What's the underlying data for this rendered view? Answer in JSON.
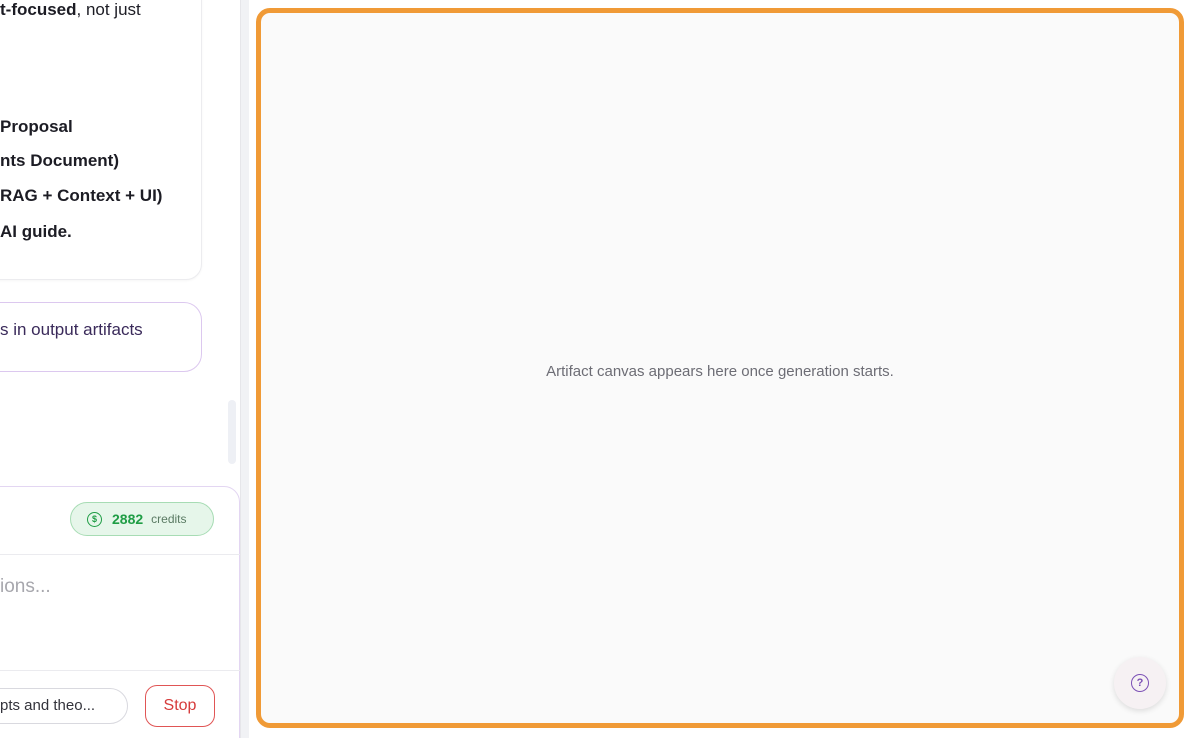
{
  "chat": {
    "assistant_lines": [
      {
        "bold": "t-focused",
        "rest": ", not just"
      },
      "Proposal",
      "nts Document)",
      "RAG + Context + UI)",
      "AI guide."
    ],
    "user_message": "s in output artifacts"
  },
  "composer": {
    "credits": {
      "count": "2882",
      "label": "credits",
      "icon": "dollar-coin-icon"
    },
    "placeholder": "ions...",
    "suggestion": "pts and theo...",
    "stop_label": "Stop"
  },
  "canvas": {
    "empty_message": "Artifact canvas appears here once generation starts.",
    "help_icon": "question-icon",
    "border_color": "#f09a36"
  }
}
